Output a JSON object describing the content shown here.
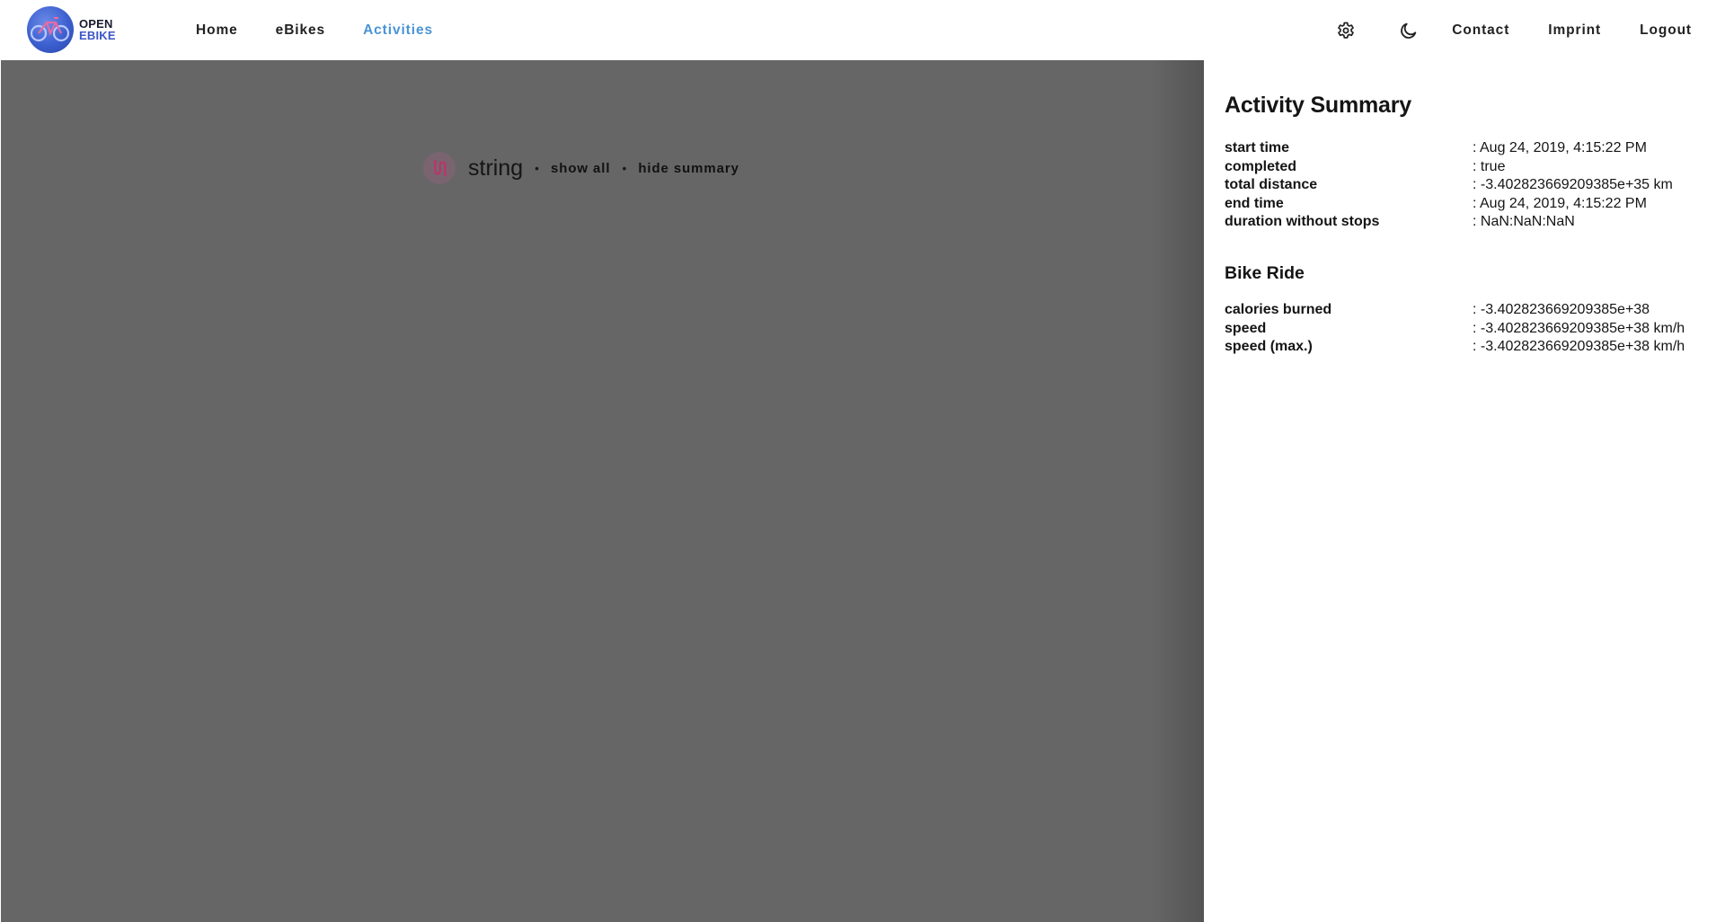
{
  "brand": {
    "line1": "OPEN",
    "line2": "EBIKE"
  },
  "nav": {
    "items": [
      {
        "label": "Home",
        "active": false
      },
      {
        "label": "eBikes",
        "active": false
      },
      {
        "label": "Activities",
        "active": true
      }
    ]
  },
  "toolbar": {
    "settings_icon": "gear-icon",
    "theme_icon": "moon-icon",
    "contact_label": "Contact",
    "imprint_label": "Imprint",
    "logout_label": "Logout"
  },
  "activity": {
    "icon": "route-icon",
    "title": "string",
    "separator": "•",
    "show_all_label": "show all",
    "hide_summary_label": "hide summary"
  },
  "summary": {
    "title": "Activity Summary",
    "rows": [
      {
        "key": "start time",
        "value": ": Aug 24, 2019, 4:15:22 PM"
      },
      {
        "key": "completed",
        "value": ": true"
      },
      {
        "key": "total distance",
        "value": ": -3.402823669209385e+35 km"
      },
      {
        "key": "end time",
        "value": ": Aug 24, 2019, 4:15:22 PM"
      },
      {
        "key": "duration without stops",
        "value": ": NaN:NaN:NaN"
      }
    ]
  },
  "bike_ride": {
    "title": "Bike Ride",
    "rows": [
      {
        "key": "calories burned",
        "value": ": -3.402823669209385e+38"
      },
      {
        "key": "speed",
        "value": ": -3.402823669209385e+38 km/h"
      },
      {
        "key": "speed (max.)",
        "value": ": -3.402823669209385e+38 km/h"
      }
    ]
  },
  "colors": {
    "accent": "#4a94d4",
    "overlay": "#666666",
    "brand_blue": "#3d56c6",
    "route_icon_bg": "#7a6470",
    "route_icon_stroke": "#c0306a"
  }
}
